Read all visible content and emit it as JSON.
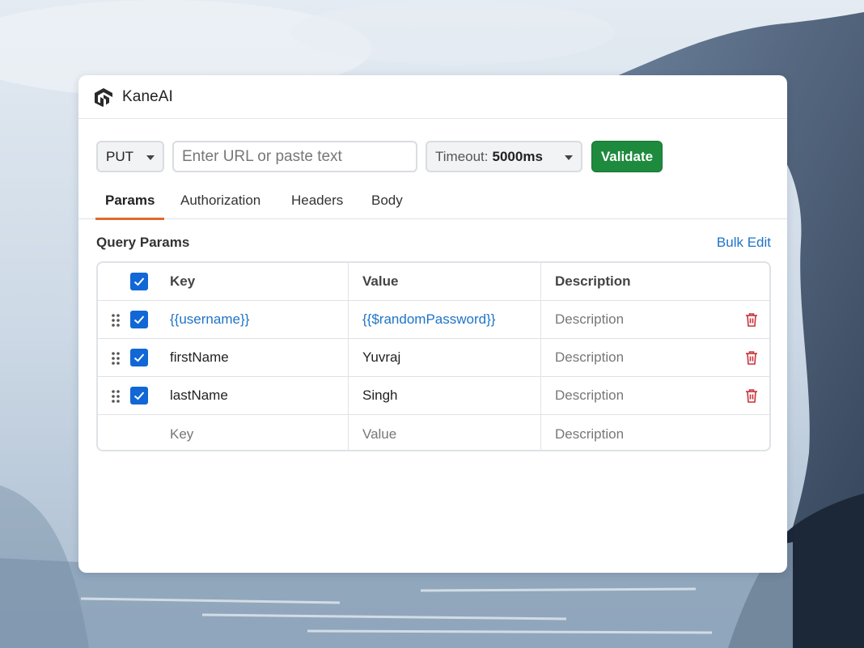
{
  "app": {
    "name": "KaneAI",
    "logo_icon": "kaneai-logo-icon"
  },
  "request": {
    "method": "PUT",
    "url_value": "",
    "url_placeholder": "Enter URL or paste text",
    "timeout_label": "Timeout:",
    "timeout_value": "5000ms",
    "validate_label": "Validate"
  },
  "tabs": [
    {
      "label": "Params",
      "active": true
    },
    {
      "label": "Authorization",
      "active": false
    },
    {
      "label": "Headers",
      "active": false
    },
    {
      "label": "Body",
      "active": false
    }
  ],
  "query_params": {
    "title": "Query Params",
    "bulk_edit_label": "Bulk Edit",
    "columns": [
      "Key",
      "Value",
      "Description"
    ],
    "rows": [
      {
        "key": "{{username}}",
        "value": "{{$randomPassword}}",
        "description": "Description",
        "checked": true,
        "is_variable": true
      },
      {
        "key": "firstName",
        "value": "Yuvraj",
        "description": "Description",
        "checked": true,
        "is_variable": false
      },
      {
        "key": "lastName",
        "value": "Singh",
        "description": "Description",
        "checked": true,
        "is_variable": false
      }
    ],
    "new_row": {
      "key_placeholder": "Key",
      "value_placeholder": "Value",
      "description_placeholder": "Description"
    }
  },
  "colors": {
    "accent_tab": "#e06a2c",
    "validate_button": "#1e8a3e",
    "checkbox": "#1167d6",
    "link": "#1e73c8",
    "delete_icon": "#c8323a"
  }
}
